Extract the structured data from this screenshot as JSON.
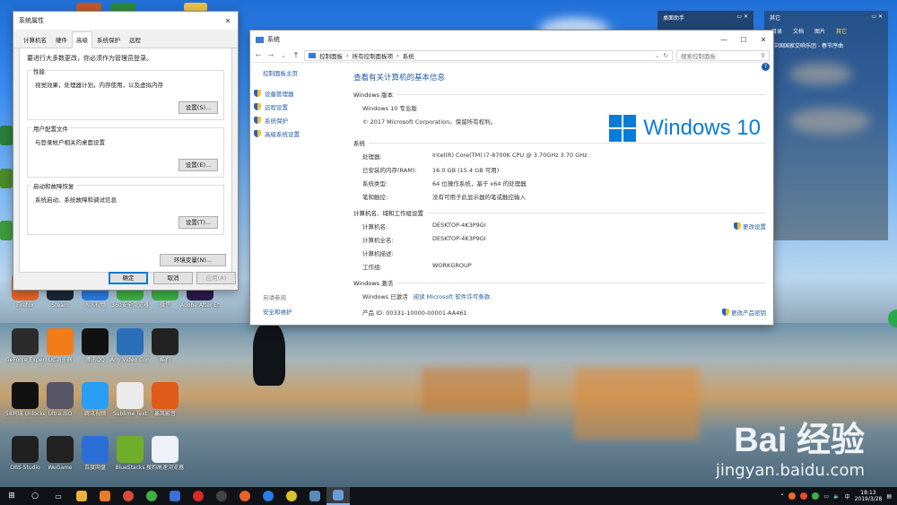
{
  "system_properties": {
    "title": "系统属性",
    "close": "✕",
    "tabs": [
      "计算机名",
      "硬件",
      "高级",
      "系统保护",
      "远程"
    ],
    "active_tab": "高级",
    "admin_note": "要进行大多数更改，你必须作为管理员登录。",
    "groups": [
      {
        "label": "性能",
        "desc": "视觉效果，处理器计划，内存使用，以及虚拟内存",
        "button": "设置(S)..."
      },
      {
        "label": "用户配置文件",
        "desc": "与登录帐户相关的桌面设置",
        "button": "设置(E)..."
      },
      {
        "label": "启动和故障恢复",
        "desc": "系统启动、系统故障和调试信息",
        "button": "设置(T)..."
      }
    ],
    "env_button": "环境变量(N)...",
    "ok": "确定",
    "cancel": "取消",
    "apply": "应用(A)"
  },
  "system_window": {
    "title": "系统",
    "address": [
      "控制面板",
      "所有控制面板项",
      "系统"
    ],
    "search_placeholder": "搜索控制面板",
    "left": {
      "home": "控制面板主页",
      "items": [
        "设备管理器",
        "远程设置",
        "系统保护",
        "高级系统设置"
      ],
      "see_also_header": "另请参阅",
      "see_also_link": "安全和维护"
    },
    "heading": "查看有关计算机的基本信息",
    "edition_header": "Windows 版本",
    "edition": "Windows 10 专业版",
    "copyright": "© 2017 Microsoft Corporation。保留所有权利。",
    "logo_text": "Windows 10",
    "system_header": "系统",
    "system_rows": [
      {
        "k": "处理器:",
        "v": "Intel(R) Core(TM) i7-8700K CPU @ 3.70GHz   3.70 GHz"
      },
      {
        "k": "已安装的内存(RAM):",
        "v": "16.0 GB (15.4 GB 可用)"
      },
      {
        "k": "系统类型:",
        "v": "64 位操作系统，基于 x64 的处理器"
      },
      {
        "k": "笔和触控:",
        "v": "没有可用于此显示器的笔或触控输入"
      }
    ],
    "computer_header": "计算机名、域和工作组设置",
    "computer_rows": [
      {
        "k": "计算机名:",
        "v": "DESKTOP-4K3P9GI"
      },
      {
        "k": "计算机全名:",
        "v": "DESKTOP-4K3P9GI"
      },
      {
        "k": "计算机描述:",
        "v": ""
      },
      {
        "k": "工作组:",
        "v": "WORKGROUP"
      }
    ],
    "change_settings": "更改设置",
    "activation_header": "Windows 激活",
    "activated": "Windows 已激活",
    "license_link": "阅读 Microsoft 软件许可条款",
    "product_id": "产品 ID: 00331-10000-00001-AA461",
    "change_key": "更改产品密钥"
  },
  "widgets": {
    "desk_title": "桌面助手",
    "news_title": "其它",
    "news_tabs": [
      "目录",
      "文档",
      "图片",
      "其它"
    ],
    "news_item": "中国国家交响乐团 - 春节序曲"
  },
  "desktop_icons": [
    {
      "label": "Firefox",
      "color": "#e8632a"
    },
    {
      "label": "Steam",
      "color": "#1b2838"
    },
    {
      "label": "人人视频",
      "color": "#2a7de1"
    },
    {
      "label": "360安全浏览器",
      "color": "#3cb043"
    },
    {
      "label": "微信",
      "color": "#3cb043"
    },
    {
      "label": "Adobe After Effects CC",
      "color": "#2a1a4a"
    },
    {
      "label": "GeForce Experience",
      "color": "#2b2b2b"
    },
    {
      "label": "UC浏览器",
      "color": "#f07c1a"
    },
    {
      "label": "腾讯QQ",
      "color": "#111111"
    },
    {
      "label": "Any Video Converter",
      "color": "#2a6fb8"
    },
    {
      "label": "酷狗",
      "color": "#222222"
    },
    {
      "label": "58同城 Unlocker",
      "color": "#111111"
    },
    {
      "label": "Ultra ISO",
      "color": "#555566"
    },
    {
      "label": "腾讯视频",
      "color": "#2a9df4"
    },
    {
      "label": "Sublime Text",
      "color": "#eaeaea"
    },
    {
      "label": "暴风影音",
      "color": "#e05a1a"
    },
    {
      "label": "OBS Studio",
      "color": "#202020"
    },
    {
      "label": "WeGame",
      "color": "#222222"
    },
    {
      "label": "百度网盘",
      "color": "#2a6fd6"
    },
    {
      "label": "BlueStacks",
      "color": "#6fae2a"
    },
    {
      "label": "搜狗高速浏览器",
      "color": "#eef2f8"
    }
  ],
  "taskbar": {
    "time": "18:13",
    "date": "2019/3/28",
    "ime": "中"
  },
  "watermark": {
    "brand": "Bai 经验",
    "url": "jingyan.baidu.com"
  }
}
